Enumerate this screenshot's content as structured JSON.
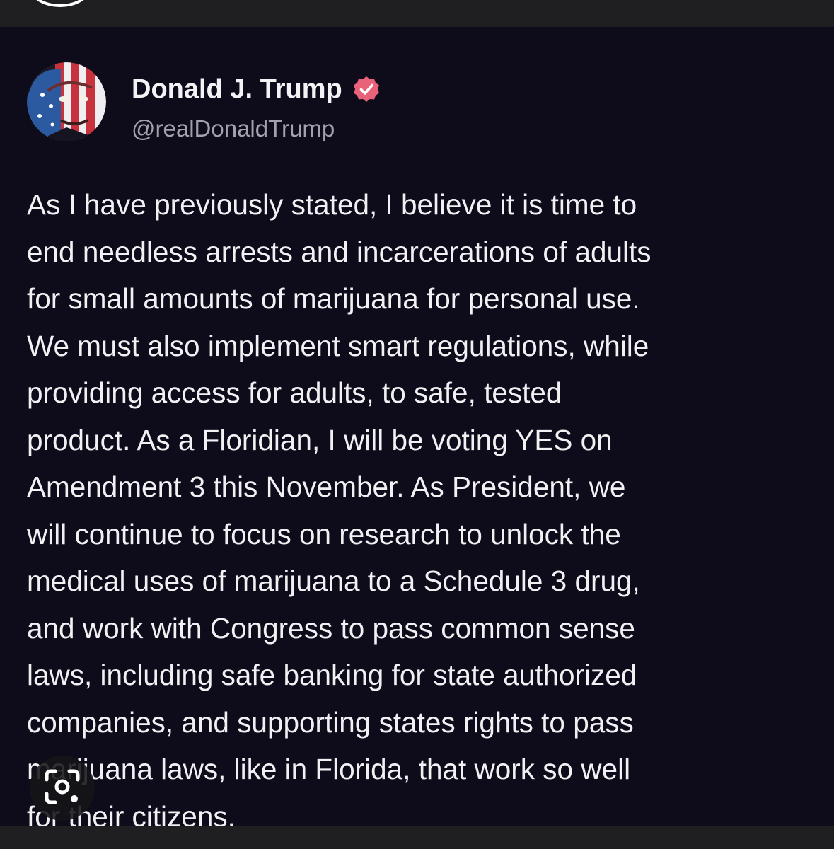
{
  "post": {
    "author_name": "Donald J. Trump",
    "author_handle": "@realDonaldTrump",
    "verified": true,
    "badge_color": "#e8627a",
    "background_color": "#0e0b1a",
    "body_lines": [
      "As I have previously stated, I believe it is time to",
      "end needless arrests and incarcerations of adults",
      "for small amounts of marijuana for personal use.",
      "We must also implement smart regulations, while",
      "providing access for adults, to safe, tested",
      "product. As a Floridian, I will be voting YES on",
      "Amendment 3 this November. As President, we",
      "will continue to focus on research to unlock the",
      "medical uses of marijuana to a Schedule 3 drug,",
      "and work with Congress to pass common sense",
      "laws, including safe banking for state authorized",
      "companies, and supporting states rights to pass",
      "marijuana laws, like in Florida, that work so well",
      "for their citizens."
    ]
  },
  "overlay": {
    "icon": "visual-search-lens-icon"
  }
}
